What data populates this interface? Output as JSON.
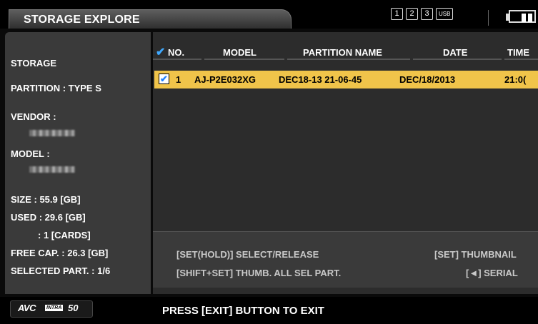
{
  "header": {
    "title": "STORAGE EXPLORE",
    "slots": [
      "1",
      "2",
      "3",
      "USB"
    ]
  },
  "storage": {
    "heading": "STORAGE",
    "partition": "PARTITION : TYPE S",
    "vendor_label": "VENDOR :",
    "model_label": "MODEL :",
    "size": "SIZE : 55.9 [GB]",
    "used": "USED : 29.6 [GB]",
    "cards": ": 1 [CARDS]",
    "free": "FREE CAP. : 26.3 [GB]",
    "selected": "SELECTED PART. : 1/6"
  },
  "table": {
    "columns": {
      "no": "NO.",
      "model": "MODEL",
      "partition": "PARTITION NAME",
      "date": "DATE",
      "time": "TIME"
    },
    "rows": [
      {
        "no": "1",
        "model": "AJ-P2E032XG",
        "partition": "DEC18-13 21-06-45",
        "date": "DEC/18/2013",
        "time": "21:0("
      }
    ]
  },
  "help": {
    "select": "[SET(HOLD)] SELECT/RELEASE",
    "thumbnail": "[SET] THUMBNAIL",
    "thumb_all": "[SHIFT+SET] THUMB. ALL SEL PART.",
    "serial": "[◄] SERIAL"
  },
  "footer": {
    "logo_avc": "AVC",
    "logo_intra": "INTRA",
    "logo_num": "50",
    "exit": "PRESS [EXIT] BUTTON TO EXIT"
  },
  "colors": {
    "highlight": "#f0c44a",
    "check": "#3fa9ff"
  }
}
